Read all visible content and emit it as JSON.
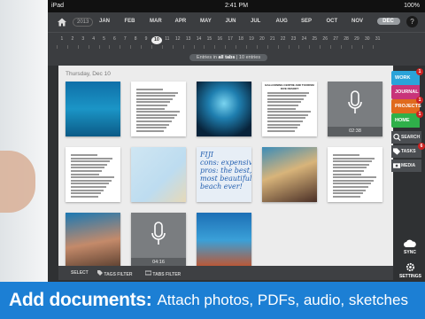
{
  "status_bar": {
    "device": "iPad",
    "time": "2:41 PM",
    "battery": "100%"
  },
  "month_bar": {
    "year": "2013",
    "months": [
      "JAN",
      "FEB",
      "MAR",
      "APR",
      "MAY",
      "JUN",
      "JUL",
      "AUG",
      "SEP",
      "OCT",
      "NOV",
      "DEC"
    ],
    "active_month": "DEC"
  },
  "days": [
    "1",
    "2",
    "3",
    "4",
    "5",
    "6",
    "7",
    "8",
    "9",
    "10",
    "11",
    "12",
    "13",
    "14",
    "15",
    "16",
    "17",
    "18",
    "19",
    "20",
    "21",
    "22",
    "23",
    "24",
    "25",
    "26",
    "27",
    "28",
    "29",
    "30",
    "31"
  ],
  "active_day": "10",
  "filter": {
    "prefix": "Entries in",
    "scope": "all tabs",
    "count": "10 entries"
  },
  "content": {
    "date_label": "Thursday, Dec 10",
    "items": [
      {
        "type": "photo",
        "subject": "reef-fish-photo"
      },
      {
        "type": "document",
        "subject": "pdf-document"
      },
      {
        "type": "photo",
        "subject": "underwater-cave-photo"
      },
      {
        "type": "document",
        "subject": "pdf-document",
        "title": "BALLOONING CENTRE AND TOURISM DIVE RESORT"
      },
      {
        "type": "audio",
        "duration": "02:38"
      },
      {
        "type": "document",
        "subject": "pdf-document"
      },
      {
        "type": "map",
        "subject": "map-image"
      },
      {
        "type": "handwriting",
        "text": "FIJI\ncons: expensive\npros: the best,\nmost beautiful\nbeach ever!"
      },
      {
        "type": "photo",
        "subject": "coral-photo"
      },
      {
        "type": "document",
        "subject": "table-document"
      },
      {
        "type": "photo",
        "subject": "diver-fan-coral-photo"
      },
      {
        "type": "audio",
        "duration": "04:16"
      },
      {
        "type": "photo",
        "subject": "diver-photo"
      }
    ]
  },
  "bottom_bar": {
    "select": "SELECT",
    "tags_filter": "TAGS FILTER",
    "tabs_filter": "TABS FILTER"
  },
  "sidebar": {
    "tabs": [
      {
        "label": "WORK",
        "color": "#2aa3d9",
        "badge": "1"
      },
      {
        "label": "JOURNAL",
        "color": "#c8347a",
        "badge": ""
      },
      {
        "label": "PROJECTS",
        "color": "#e06a1d",
        "badge": "1"
      },
      {
        "label": "HOME",
        "color": "#2fb04a",
        "badge": "1"
      }
    ],
    "tools": [
      {
        "label": "SEARCH",
        "icon": "search-icon"
      },
      {
        "label": "TASKS",
        "icon": "tag-icon",
        "badge": "6"
      },
      {
        "label": "MEDIA",
        "icon": "media-icon"
      }
    ],
    "sync_label": "SYNC",
    "settings_label": "SETTINGS"
  },
  "banner": {
    "bold": "Add documents:",
    "rest": "Attach photos, PDFs, audio, sketches"
  }
}
